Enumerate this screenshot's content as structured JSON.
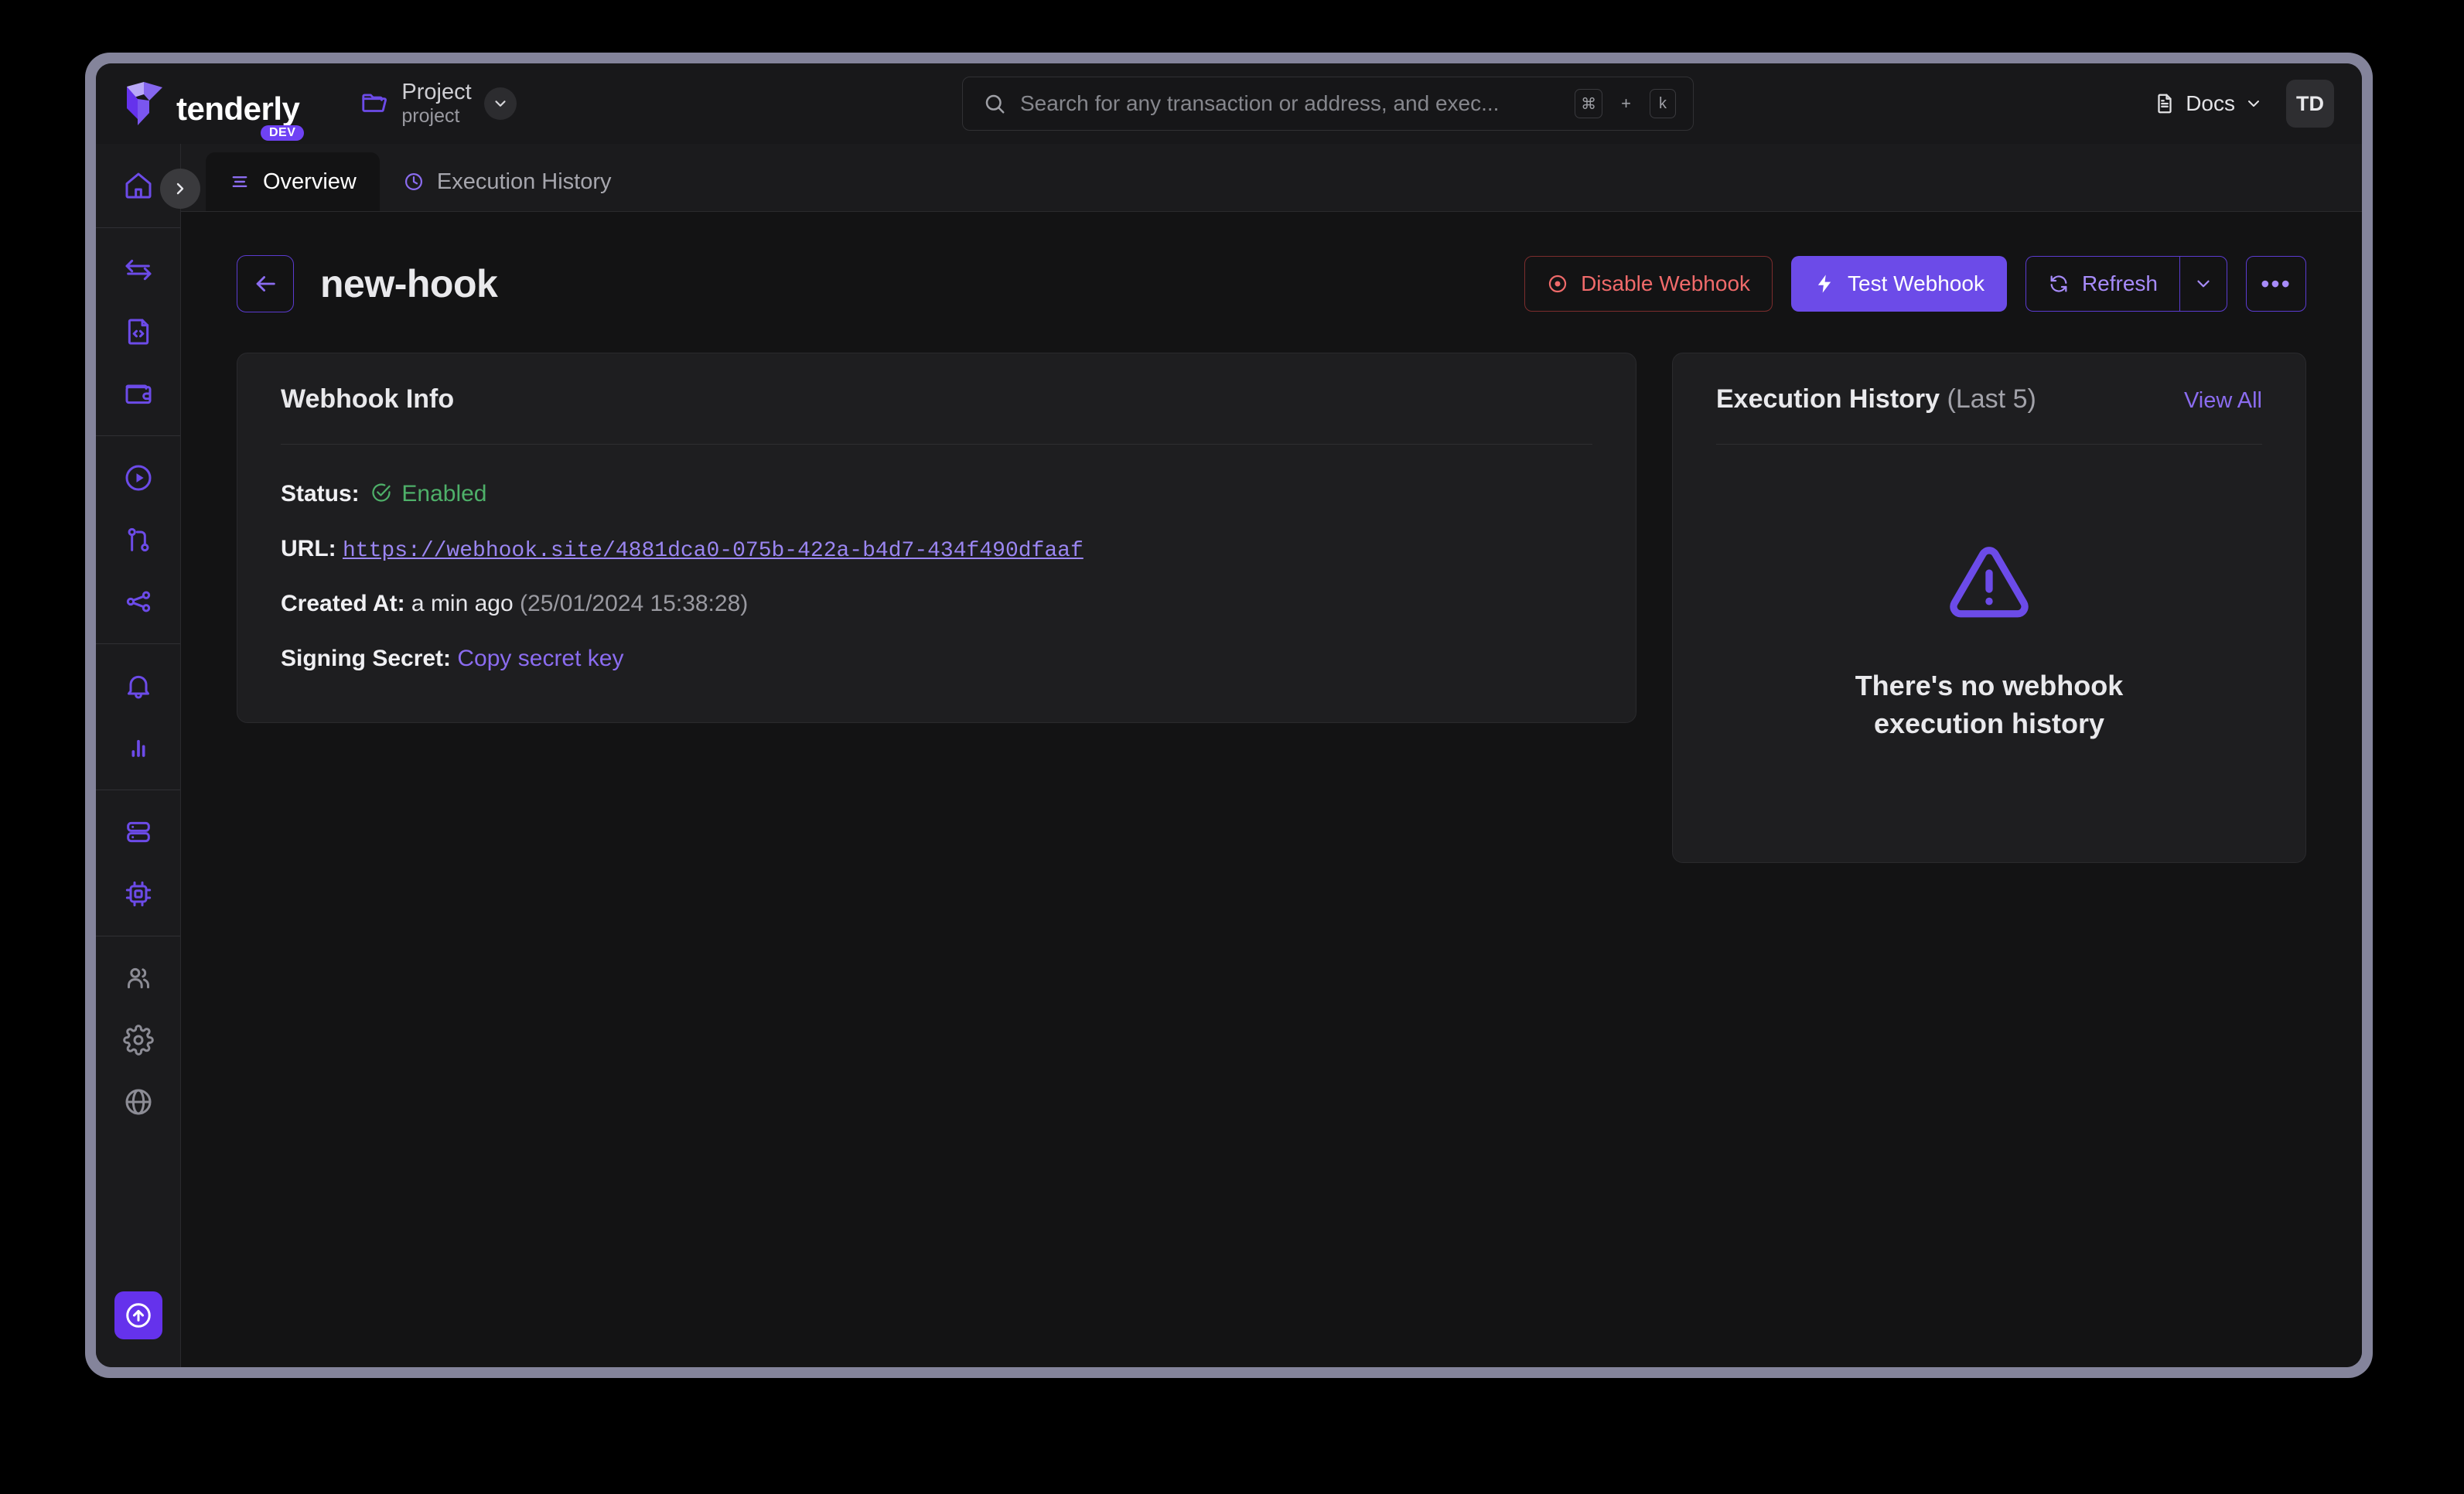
{
  "brand": {
    "name": "tenderly",
    "badge": "DEV"
  },
  "project": {
    "name": "Project",
    "sub": "project"
  },
  "search": {
    "placeholder": "Search for any transaction or address, and exec...",
    "value": "",
    "kbd_mod": "⌘",
    "kbd_plus": "+",
    "kbd_key": "k"
  },
  "topright": {
    "docs_label": "Docs",
    "avatar_initials": "TD"
  },
  "sidebar": {
    "groups": [
      {
        "items": [
          {
            "icon": "home-icon",
            "name": "sidebar-item-home",
            "active": true
          }
        ]
      },
      {
        "items": [
          {
            "icon": "transactions-icon",
            "name": "sidebar-item-transactions"
          },
          {
            "icon": "contracts-icon",
            "name": "sidebar-item-contracts"
          },
          {
            "icon": "wallets-icon",
            "name": "sidebar-item-wallets"
          }
        ]
      },
      {
        "items": [
          {
            "icon": "simulator-icon",
            "name": "sidebar-item-simulator"
          },
          {
            "icon": "forks-icon",
            "name": "sidebar-item-forks"
          },
          {
            "icon": "devnets-icon",
            "name": "sidebar-item-devnets"
          }
        ]
      },
      {
        "items": [
          {
            "icon": "bell-icon",
            "name": "sidebar-item-alerts"
          },
          {
            "icon": "analytics-icon",
            "name": "sidebar-item-analytics"
          }
        ]
      },
      {
        "items": [
          {
            "icon": "server-icon",
            "name": "sidebar-item-node"
          },
          {
            "icon": "chip-icon",
            "name": "sidebar-item-gateway"
          }
        ]
      },
      {
        "items": [
          {
            "icon": "users-icon",
            "name": "sidebar-item-collaborators"
          },
          {
            "icon": "gear-icon",
            "name": "sidebar-item-settings"
          },
          {
            "icon": "globe-icon",
            "name": "sidebar-item-explorer"
          }
        ]
      }
    ],
    "fab_icon": "arrow-up-circle-icon",
    "toggle_icon": "chevron-right-icon"
  },
  "tabs": [
    {
      "label": "Overview",
      "icon": "list-icon",
      "active": true
    },
    {
      "label": "Execution History",
      "icon": "clock-icon",
      "active": false
    }
  ],
  "page": {
    "title": "new-hook",
    "back_icon": "arrow-left-icon"
  },
  "actions": {
    "disable_label": "Disable Webhook",
    "test_label": "Test Webhook",
    "refresh_label": "Refresh",
    "more_label": "•••"
  },
  "info_card": {
    "title": "Webhook Info",
    "status_label": "Status:",
    "status_value": "Enabled",
    "url_label": "URL:",
    "url_value": "https://webhook.site/4881dca0-075b-422a-b4d7-434f490dfaaf",
    "created_label": "Created At:",
    "created_value": "a min ago",
    "created_exact": "(25/01/2024 15:38:28)",
    "secret_label": "Signing Secret:",
    "secret_action": "Copy secret key"
  },
  "history_card": {
    "title": "Execution History",
    "title_suffix": "(Last 5)",
    "view_all": "View All",
    "empty_line1": "There's no webhook",
    "empty_line2": "execution history"
  },
  "colors": {
    "accent": "#6c4be8",
    "accent_light": "#a78bfa",
    "danger": "#f06a6a",
    "success": "#4eb069",
    "page_bg": "#131314",
    "card_bg": "#1e1e20",
    "frame": "#84849b"
  }
}
